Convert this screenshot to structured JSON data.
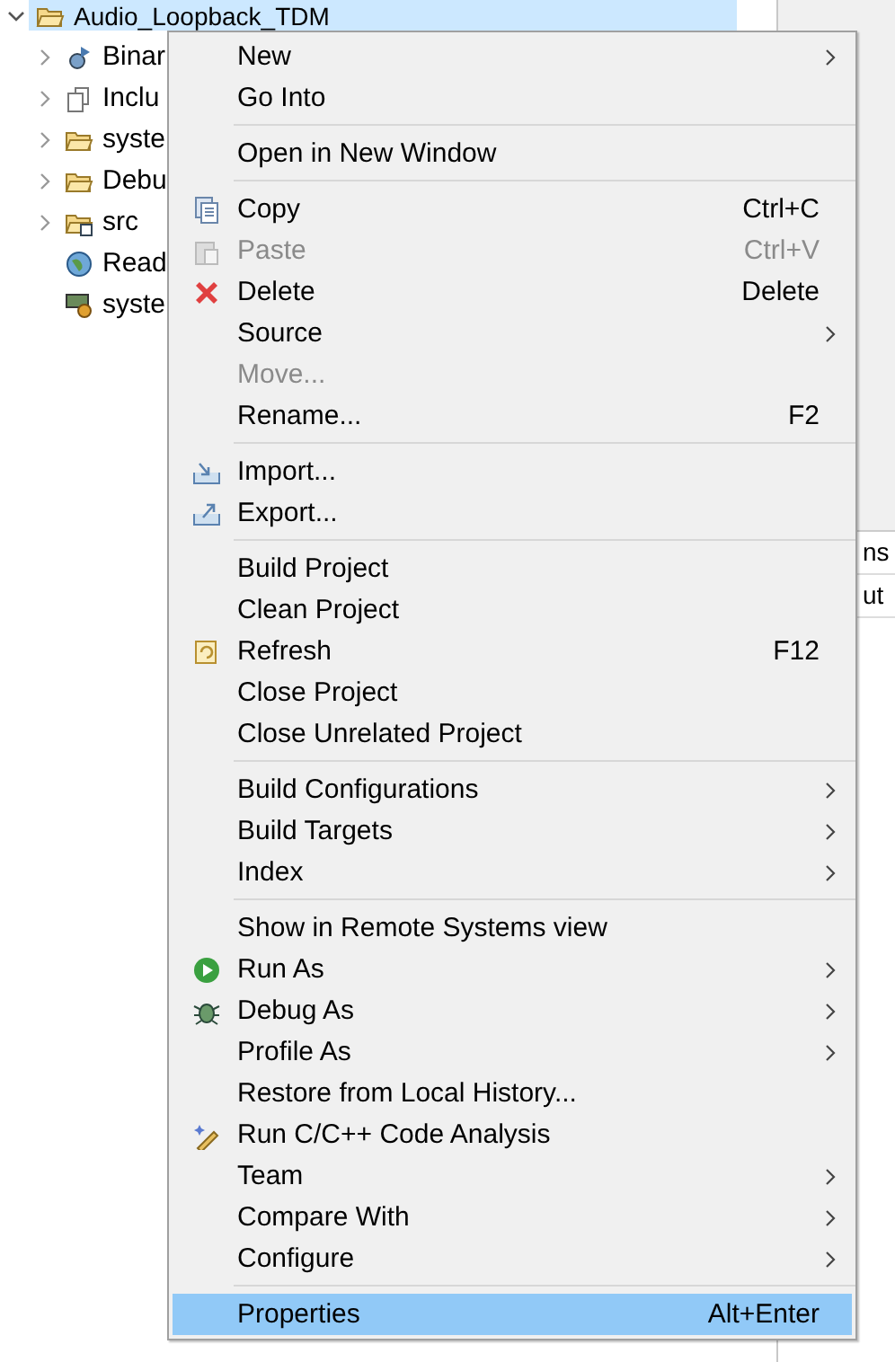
{
  "tree": {
    "root": {
      "label": "Audio_Loopback_TDM",
      "expanded": true,
      "selected": true
    },
    "children": [
      {
        "label": "Binar",
        "expandable": true
      },
      {
        "label": "Inclu",
        "expandable": true
      },
      {
        "label": "syste",
        "expandable": true
      },
      {
        "label": "Debu",
        "expandable": true
      },
      {
        "label": "src",
        "expandable": true
      },
      {
        "label": "Read",
        "expandable": false
      },
      {
        "label": "syste",
        "expandable": false
      }
    ]
  },
  "side_panel": {
    "rows": [
      "ns",
      "ut"
    ]
  },
  "context_menu": {
    "items": [
      {
        "kind": "item",
        "label": "New",
        "submenu": true,
        "disabled": false,
        "selected": false
      },
      {
        "kind": "item",
        "label": "Go Into",
        "submenu": false,
        "disabled": false,
        "selected": false
      },
      {
        "kind": "separator"
      },
      {
        "kind": "item",
        "label": "Open in New Window",
        "submenu": false,
        "disabled": false,
        "selected": false
      },
      {
        "kind": "separator"
      },
      {
        "kind": "item",
        "label": "Copy",
        "shortcut": "Ctrl+C",
        "submenu": false,
        "disabled": false,
        "selected": false
      },
      {
        "kind": "item",
        "label": "Paste",
        "shortcut": "Ctrl+V",
        "submenu": false,
        "disabled": true,
        "selected": false
      },
      {
        "kind": "item",
        "label": "Delete",
        "shortcut": "Delete",
        "submenu": false,
        "disabled": false,
        "selected": false
      },
      {
        "kind": "item",
        "label": "Source",
        "submenu": true,
        "disabled": false,
        "selected": false
      },
      {
        "kind": "item",
        "label": "Move...",
        "submenu": false,
        "disabled": true,
        "selected": false
      },
      {
        "kind": "item",
        "label": "Rename...",
        "shortcut": "F2",
        "submenu": false,
        "disabled": false,
        "selected": false
      },
      {
        "kind": "separator"
      },
      {
        "kind": "item",
        "label": "Import...",
        "submenu": false,
        "disabled": false,
        "selected": false
      },
      {
        "kind": "item",
        "label": "Export...",
        "submenu": false,
        "disabled": false,
        "selected": false
      },
      {
        "kind": "separator"
      },
      {
        "kind": "item",
        "label": "Build Project",
        "submenu": false,
        "disabled": false,
        "selected": false
      },
      {
        "kind": "item",
        "label": "Clean Project",
        "submenu": false,
        "disabled": false,
        "selected": false
      },
      {
        "kind": "item",
        "label": "Refresh",
        "shortcut": "F12",
        "submenu": false,
        "disabled": false,
        "selected": false
      },
      {
        "kind": "item",
        "label": "Close Project",
        "submenu": false,
        "disabled": false,
        "selected": false
      },
      {
        "kind": "item",
        "label": "Close Unrelated Project",
        "submenu": false,
        "disabled": false,
        "selected": false
      },
      {
        "kind": "separator"
      },
      {
        "kind": "item",
        "label": "Build Configurations",
        "submenu": true,
        "disabled": false,
        "selected": false
      },
      {
        "kind": "item",
        "label": "Build Targets",
        "submenu": true,
        "disabled": false,
        "selected": false
      },
      {
        "kind": "item",
        "label": "Index",
        "submenu": true,
        "disabled": false,
        "selected": false
      },
      {
        "kind": "separator"
      },
      {
        "kind": "item",
        "label": "Show in Remote Systems view",
        "submenu": false,
        "disabled": false,
        "selected": false
      },
      {
        "kind": "item",
        "label": "Run As",
        "submenu": true,
        "disabled": false,
        "selected": false
      },
      {
        "kind": "item",
        "label": "Debug As",
        "submenu": true,
        "disabled": false,
        "selected": false
      },
      {
        "kind": "item",
        "label": "Profile As",
        "submenu": true,
        "disabled": false,
        "selected": false
      },
      {
        "kind": "item",
        "label": "Restore from Local History...",
        "submenu": false,
        "disabled": false,
        "selected": false
      },
      {
        "kind": "item",
        "label": "Run C/C++ Code Analysis",
        "submenu": false,
        "disabled": false,
        "selected": false
      },
      {
        "kind": "item",
        "label": "Team",
        "submenu": true,
        "disabled": false,
        "selected": false
      },
      {
        "kind": "item",
        "label": "Compare With",
        "submenu": true,
        "disabled": false,
        "selected": false
      },
      {
        "kind": "item",
        "label": "Configure",
        "submenu": true,
        "disabled": false,
        "selected": false
      },
      {
        "kind": "separator"
      },
      {
        "kind": "item",
        "label": "Properties",
        "shortcut": "Alt+Enter",
        "submenu": false,
        "disabled": false,
        "selected": true
      }
    ]
  }
}
